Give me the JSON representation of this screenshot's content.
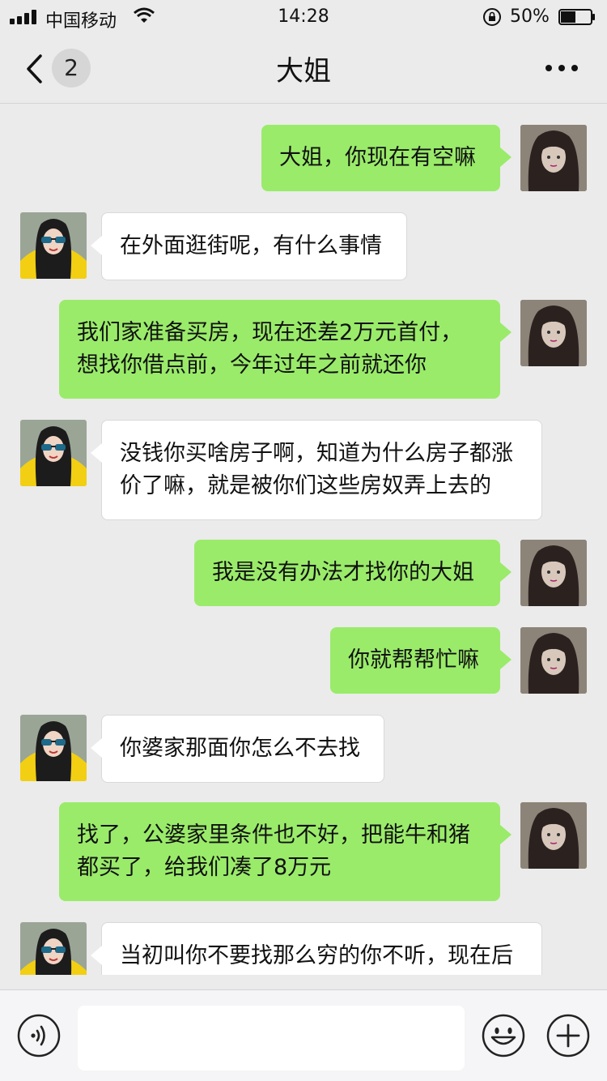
{
  "status_bar": {
    "carrier": "中国移动",
    "time": "14:28",
    "battery_percent": "50%",
    "battery_level": 0.5,
    "icons": [
      "signal-icon",
      "wifi-icon",
      "orientation-lock-icon",
      "battery-icon"
    ]
  },
  "nav": {
    "unread_count": "2",
    "title": "大姐",
    "icons": [
      "back-chevron-icon",
      "more-icon"
    ]
  },
  "messages": [
    {
      "side": "right",
      "text": "大姐，你现在有空嘛"
    },
    {
      "side": "left",
      "text": "在外面逛街呢，有什么事情"
    },
    {
      "side": "right",
      "text": "我们家准备买房，现在还差2万元首付，想找你借点前，今年过年之前就还你"
    },
    {
      "side": "left",
      "text": "没钱你买啥房子啊，知道为什么房子都涨价了嘛，就是被你们这些房奴弄上去的"
    },
    {
      "side": "right",
      "text": "我是没有办法才找你的大姐"
    },
    {
      "side": "right",
      "text": "你就帮帮忙嘛"
    },
    {
      "side": "left",
      "text": "你婆家那面你怎么不去找"
    },
    {
      "side": "right",
      "text": "找了，公婆家里条件也不好，把能牛和猪都买了，给我们凑了8万元"
    },
    {
      "side": "left",
      "text": "当初叫你不要找那么穷的你不听，现在后"
    }
  ],
  "input_bar": {
    "value": "",
    "placeholder": "",
    "icons": [
      "voice-icon",
      "emoji-icon",
      "plus-icon"
    ]
  },
  "colors": {
    "background": "#ebebeb",
    "outgoing_bubble": "#9aeb6a",
    "incoming_bubble": "#ffffff"
  }
}
